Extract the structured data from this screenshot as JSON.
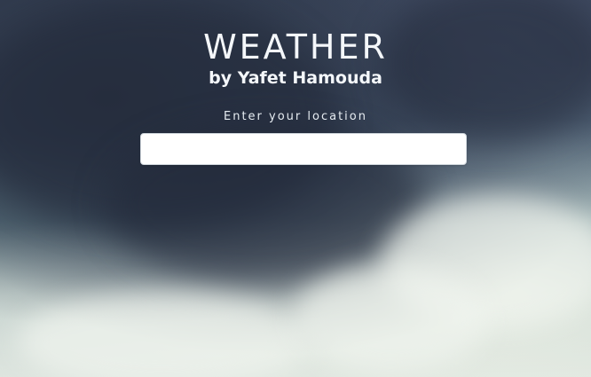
{
  "header": {
    "title": "WEATHER",
    "byline": "by Yafet Hamouda"
  },
  "search": {
    "label": "Enter your location",
    "value": "",
    "placeholder": ""
  },
  "colors": {
    "title_text": "#f4f7fa",
    "input_background": "#ffffff",
    "sky_dark": "#39455a",
    "sky_light": "#dfe6e0"
  }
}
